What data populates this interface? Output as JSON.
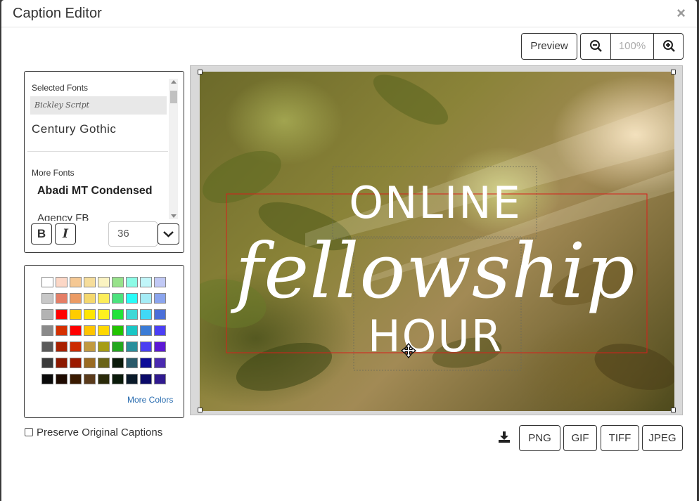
{
  "dialog": {
    "title": "Caption Editor",
    "close_label": "×"
  },
  "toolbar": {
    "preview_label": "Preview",
    "zoom_value": "100%"
  },
  "fonts": {
    "selected_label": "Selected Fonts",
    "selected": [
      "Bickley Script",
      "Century Gothic"
    ],
    "more_label": "More Fonts",
    "more": [
      "Abadi MT Condensed",
      "Agency FB"
    ],
    "bold_label": "B",
    "italic_label": "I",
    "size": "36"
  },
  "colors": {
    "rows": [
      [
        "#ffffff",
        "#fcd7c6",
        "#f5c894",
        "#f6dd9b",
        "#fbf3c2",
        "#97e28b",
        "#8cfbe6",
        "#c1f6f9",
        "#c1c9f5"
      ],
      [
        "#c8c8c8",
        "#e57e66",
        "#eb9b65",
        "#f5d86e",
        "#fced5a",
        "#4ce37e",
        "#29fcf8",
        "#a5ecf6",
        "#8ba5ee"
      ],
      [
        "#b3b3b3",
        "#ff0000",
        "#ffcc00",
        "#ffe600",
        "#fff11f",
        "#22e33a",
        "#3fd8d6",
        "#41d8f7",
        "#4b6fd9"
      ],
      [
        "#8a8a8a",
        "#d53000",
        "#ff0000",
        "#ffc400",
        "#ffd800",
        "#22c400",
        "#1ac6c5",
        "#3b7cd6",
        "#4b3ff5"
      ],
      [
        "#5a5a5a",
        "#a82000",
        "#cc2b00",
        "#c19a40",
        "#a69c14",
        "#22a81e",
        "#2a8f9c",
        "#4a3ff2",
        "#5c18d4"
      ],
      [
        "#3a3a3a",
        "#8c1800",
        "#9c1a00",
        "#9a6b22",
        "#6a6418",
        "#0a1a0a",
        "#2a5a6a",
        "#0b0b98",
        "#4a2ab0"
      ],
      [
        "#0a0a0a",
        "#1e0a00",
        "#3a1a00",
        "#5a3a1a",
        "#2a2a0a",
        "#0a1a0a",
        "#0a1a2a",
        "#0a0a6a",
        "#301a90"
      ]
    ],
    "more_label": "More Colors"
  },
  "preserve": {
    "label": "Preserve Original Captions",
    "checked": false
  },
  "caption": {
    "line1": "ONLINE",
    "line2": "fellowship",
    "line3": "HOUR"
  },
  "export": {
    "formats": [
      "PNG",
      "GIF",
      "TIFF",
      "JPEG"
    ]
  },
  "icons": {
    "close": "close-icon",
    "zoom_out": "zoom-out-icon",
    "zoom_in": "zoom-in-icon",
    "download": "download-icon",
    "move": "move-icon"
  }
}
